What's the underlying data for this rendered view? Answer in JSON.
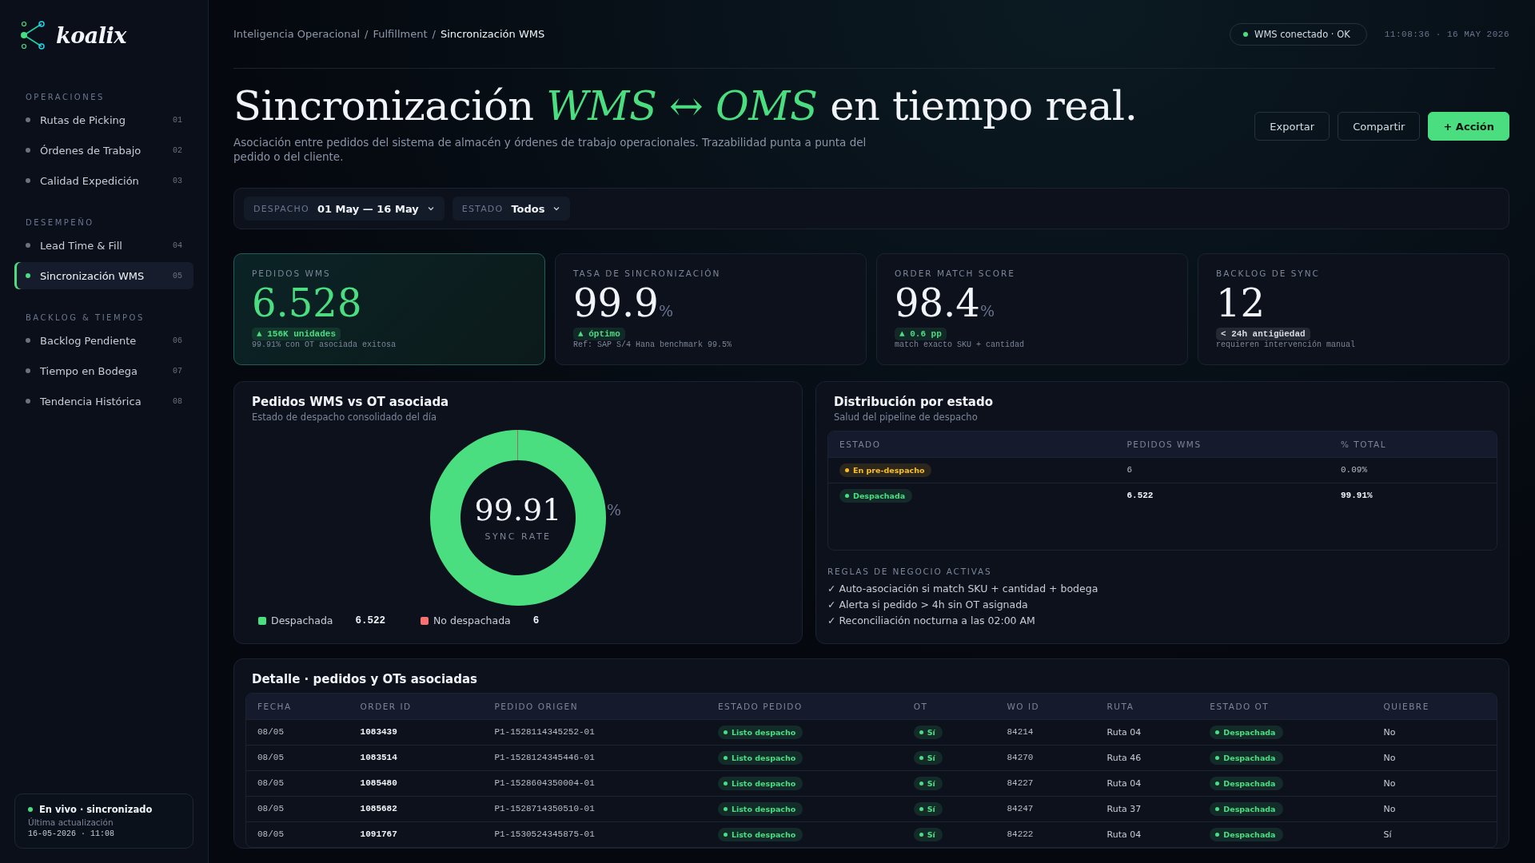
{
  "brand": {
    "name": "koalix"
  },
  "sidebar": {
    "groups": [
      {
        "title": "OPERACIONES",
        "items": [
          {
            "label": "Rutas de Picking",
            "number": "01",
            "selected": false
          },
          {
            "label": "Órdenes de Trabajo",
            "number": "02",
            "selected": false
          },
          {
            "label": "Calidad Expedición",
            "number": "03",
            "selected": false
          }
        ]
      },
      {
        "title": "DESEMPEÑO",
        "items": [
          {
            "label": "Lead Time & Fill",
            "number": "04",
            "selected": false
          },
          {
            "label": "Sincronización WMS",
            "number": "05",
            "selected": true
          }
        ]
      },
      {
        "title": "BACKLOG & TIEMPOS",
        "items": [
          {
            "label": "Backlog Pendiente",
            "number": "06",
            "selected": false
          },
          {
            "label": "Tiempo en Bodega",
            "number": "07",
            "selected": false
          },
          {
            "label": "Tendencia Histórica",
            "number": "08",
            "selected": false
          }
        ]
      }
    ],
    "status": {
      "title": "En vivo · sincronizado",
      "caption": "Última actualización",
      "timestamp": "16-05-2026 · 11:08"
    }
  },
  "breadcrumb_separators": [
    "/",
    "/"
  ],
  "breadcrumb": [
    {
      "label": "Inteligencia Operacional",
      "current": false
    },
    {
      "label": "Fulfillment",
      "current": false
    },
    {
      "label": "Sincronización WMS",
      "current": true
    }
  ],
  "connection": {
    "label": "WMS conectado · OK",
    "clock": "11:08:36 · 16 MAY 2026"
  },
  "title": "Sincronización *WMS ↔ OMS* en tiempo real.",
  "subtitle": "Asociación entre pedidos del sistema de almacén y órdenes de trabajo operacionales. Trazabilidad punta a punta del pedido o del cliente.",
  "actions": [
    {
      "label": "Exportar",
      "kind": "outline"
    },
    {
      "label": "Compartir",
      "kind": "outline"
    },
    {
      "label": "+ Acción",
      "kind": "primary"
    }
  ],
  "filters": [
    {
      "label": "DESPACHO",
      "value": "01 May — 16 May"
    },
    {
      "label": "ESTADO",
      "value": "Todos"
    }
  ],
  "kpis": [
    {
      "label": "PEDIDOS WMS",
      "value": "6.528",
      "highlighted": true,
      "badge": "▲ 156K unidades",
      "color": "#4ade80",
      "note": "99.91% con OT asociada exitosa"
    },
    {
      "label": "TASA DE SINCRONIZACIÓN",
      "value": "99.9",
      "unit": "%",
      "highlighted": false,
      "badge": "▲ óptimo",
      "color": "#4ade80",
      "note": "Ref: SAP S/4 Hana benchmark 99.5%"
    },
    {
      "label": "ORDER MATCH SCORE",
      "value": "98.4",
      "unit": "%",
      "highlighted": false,
      "badge": "▲ 0.6 pp",
      "color": "#4ade80",
      "note": "match exacto SKU + cantidad"
    },
    {
      "label": "BACKLOG DE SYNC",
      "value": "12",
      "highlighted": false,
      "badge": "< 24h antigüedad",
      "color": "#d6dbe4",
      "note": "requieren intervención manual"
    }
  ],
  "donut_card": {
    "title": "Pedidos WMS vs OT asociada",
    "subtitle": "Estado de despacho consolidado del día",
    "center_value": "99.91",
    "center_unit": "%",
    "center_label": "SYNC RATE",
    "chart_data": {
      "type": "donut",
      "categories": [
        "Despachada",
        "No despachada"
      ],
      "values": [
        99.91,
        0.09
      ]
    },
    "legend": [
      {
        "value": "6.522",
        "color": "#4ade80"
      },
      {
        "value": "6",
        "color": "#f87171"
      }
    ]
  },
  "distribution": {
    "title": "Distribución por estado",
    "subtitle": "Salud del pipeline de despacho",
    "columns": [
      "ESTADO",
      "PEDIDOS WMS",
      "% TOTAL"
    ],
    "rows": [
      {
        "status": "En pre-despacho",
        "color": "#fbbf24",
        "count": "6",
        "share": "0.09%",
        "emphasis": false
      },
      {
        "status": "Despachada",
        "color": "#4ade80",
        "count": "6.522",
        "share": "99.91%",
        "emphasis": true
      }
    ],
    "rules_title": "REGLAS DE NEGOCIO ACTIVAS",
    "rules": [
      "✓ Auto-asociación si match SKU + cantidad + bodega",
      "✓ Alerta si pedido > 4h sin OT asignada",
      "✓ Reconciliación nocturna a las 02:00 AM"
    ]
  },
  "detail": {
    "title": "Detalle · pedidos y OTs asociadas",
    "columns": [
      {
        "label": "FECHA",
        "kind": "mono"
      },
      {
        "label": "ORDER ID",
        "kind": "bold"
      },
      {
        "label": "PEDIDO ORIGEN",
        "kind": "mono"
      },
      {
        "label": "ESTADO PEDIDO",
        "kind": "pill"
      },
      {
        "label": "OT",
        "kind": "pill"
      },
      {
        "label": "WO ID",
        "kind": "mono"
      },
      {
        "label": "RUTA",
        "kind": "text"
      },
      {
        "label": "ESTADO OT",
        "kind": "pill"
      },
      {
        "label": "QUIEBRE",
        "kind": "text"
      }
    ],
    "rows": [
      [
        "08/05",
        "1083439",
        "P1-1528114345252-01",
        "Listo despacho",
        "Sí",
        "84214",
        "Ruta 04",
        "Despachada",
        "No"
      ],
      [
        "08/05",
        "1083514",
        "P1-1528124345446-01",
        "Listo despacho",
        "Sí",
        "84270",
        "Ruta 46",
        "Despachada",
        "No"
      ],
      [
        "08/05",
        "1085480",
        "P1-1528604350004-01",
        "Listo despacho",
        "Sí",
        "84227",
        "Ruta 04",
        "Despachada",
        "No"
      ],
      [
        "08/05",
        "1085682",
        "P1-1528714350510-01",
        "Listo despacho",
        "Sí",
        "84247",
        "Ruta 37",
        "Despachada",
        "No"
      ],
      [
        "08/05",
        "1091767",
        "P1-1530524345875-01",
        "Listo despacho",
        "Sí",
        "84222",
        "Ruta 04",
        "Despachada",
        "Sí"
      ]
    ]
  }
}
